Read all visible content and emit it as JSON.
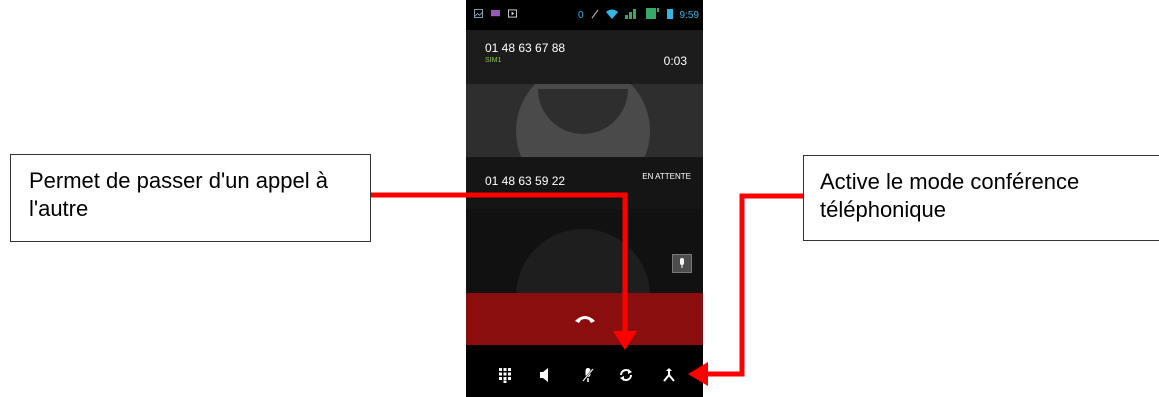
{
  "status_bar": {
    "sim_slot": "0",
    "time": "9:59",
    "icons": [
      "gallery-icon",
      "message-icon",
      "video-icon",
      "wifi-icon",
      "signal-icon",
      "battery-icon"
    ]
  },
  "active_call": {
    "number": "01 48 63 67 88",
    "sim": "SIM1",
    "duration": "0:03"
  },
  "held_call": {
    "number": "01 48 63 59 22",
    "status": "EN ATTENTE"
  },
  "controls": [
    "dialpad-icon",
    "speaker-icon",
    "mute-icon",
    "swap-calls-icon",
    "merge-calls-icon"
  ],
  "callouts": {
    "swap": "Permet de passer d'un appel à l'autre",
    "merge": "Active le mode conférence téléphonique"
  },
  "colors": {
    "end_call": "#8b0e0e",
    "arrow": "#ff0000",
    "sim_label": "#8bc34a"
  }
}
